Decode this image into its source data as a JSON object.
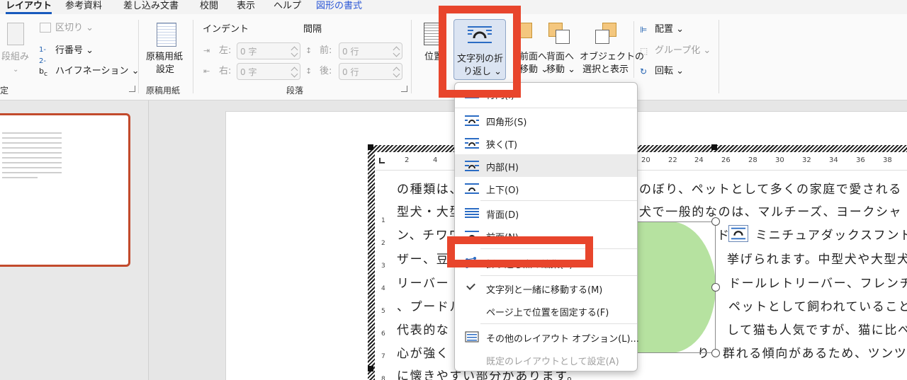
{
  "tabs": [
    {
      "label": "レイアウト",
      "state": "active"
    },
    {
      "label": "参考資料"
    },
    {
      "label": "差し込み文書"
    },
    {
      "label": "校閲"
    },
    {
      "label": "表示"
    },
    {
      "label": "ヘルプ"
    },
    {
      "label": "図形の書式",
      "state": "context"
    }
  ],
  "ribbon": {
    "page_setup": {
      "columns_label": "段組み",
      "breaks_label": "区切り",
      "line_numbers_label": "行番号",
      "hyphenation_label": "ハイフネーション",
      "group_label_partial": "定"
    },
    "genko": {
      "button_line1": "原稿用紙",
      "button_line2": "設定",
      "group_label": "原稿用紙"
    },
    "paragraph": {
      "indent_header": "インデント",
      "spacing_header": "間隔",
      "left_label": "左:",
      "right_label": "右:",
      "before_label": "前:",
      "after_label": "後:",
      "left_value": "0 字",
      "right_value": "0 字",
      "before_value": "0 行",
      "after_value": "0 行",
      "group_label": "段落"
    },
    "arrange": {
      "position_label": "位置",
      "wrap_line1": "文字列の折",
      "wrap_line2": "り返し",
      "forward_line1": "前面へ",
      "forward_line2": "移動",
      "backward_line1": "背面へ",
      "backward_line2": "移動",
      "selection_line1": "オブジェクトの",
      "selection_line2": "選択と表示",
      "align_label": "配置",
      "group_label": "グループ化",
      "rotate_label": "回転"
    }
  },
  "document": {
    "ruler_numbers": [
      "2",
      "4",
      "20",
      "22",
      "24",
      "26",
      "28",
      "30",
      "32",
      "34",
      "36",
      "38"
    ],
    "vruler_numbers": [
      "1",
      "2",
      "3",
      "4",
      "5",
      "6",
      "7",
      "8"
    ],
    "lines": [
      "の種類は、",
      "型犬・大型",
      "ン、チワワ",
      "ザー、豆",
      "リーバー",
      "、プードル",
      "代表的な",
      "心が強く",
      "に懐きやすい部分があります。"
    ],
    "right_lines": [
      "のぼり、ペットとして多くの家庭で愛される",
      "犬で一般的なのは、マルチーズ、ヨークシャ",
      "ミニチュアダックスフンド",
      "挙げられます。中型犬や大型犬",
      "ドールレトリーバー、フレンチ",
      "ペットとして飼われていること",
      "して猫も人気ですが、猫に比べ",
      "群れる傾向があるため、ツンツ"
    ],
    "fragment_do": "ド",
    "fragment_ri": "り"
  },
  "menu": {
    "items": [
      {
        "label": "行内(I)",
        "icon": "inline-icon"
      },
      {
        "label": "四角形(S)",
        "icon": "square-wrap-icon"
      },
      {
        "label": "狭く(T)",
        "icon": "tight-wrap-icon"
      },
      {
        "label": "内部(H)",
        "icon": "through-wrap-icon",
        "state": "hover"
      },
      {
        "label": "上下(O)",
        "icon": "top-bottom-icon"
      },
      {
        "label": "背面(D)",
        "icon": "behind-text-icon"
      },
      {
        "label": "前面(N)",
        "icon": "in-front-icon"
      },
      {
        "label": "折り返し点の編集(E)",
        "icon": "edit-wrap-points-icon"
      },
      {
        "label": "文字列と一緒に移動する(M)",
        "icon": "check-icon"
      },
      {
        "label": "ページ上で位置を固定する(F)"
      },
      {
        "label": "その他のレイアウト オプション(L)...",
        "icon": "layout-options-icon"
      },
      {
        "label": "既定のレイアウトとして設定(A)",
        "state": "disabled"
      }
    ]
  },
  "colors": {
    "highlight_frame": "#e8452c",
    "accent": "#185abd",
    "shape_fill": "#b6e2a0"
  }
}
